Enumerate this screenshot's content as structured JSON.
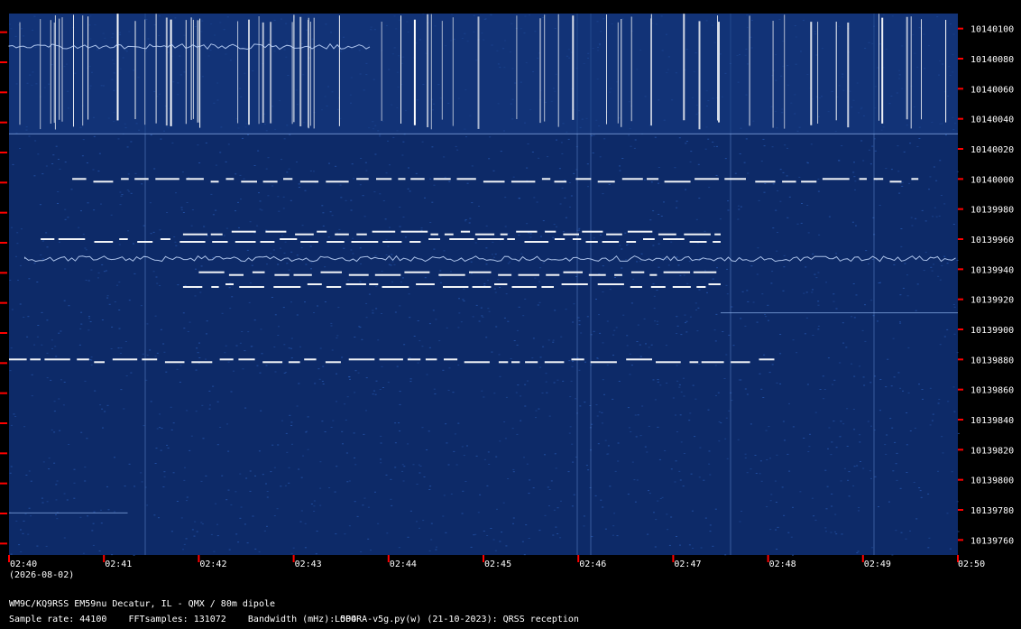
{
  "chart_data": {
    "type": "heatmap",
    "title": "",
    "x_ticks": [
      "02:40",
      "02:41",
      "02:42",
      "02:43",
      "02:44",
      "02:45",
      "02:46",
      "02:47",
      "02:48",
      "02:49",
      "02:50"
    ],
    "date_label": "(2026-08-02)",
    "y_ticks": [
      "10140100",
      "10140080",
      "10140060",
      "10140040",
      "10140020",
      "10140000",
      "10139980",
      "10139960",
      "10139940",
      "10139920",
      "10139900",
      "10139880",
      "10139860",
      "10139840",
      "10139820",
      "10139800",
      "10139780",
      "10139760"
    ],
    "ylim": [
      10139750,
      10140110
    ],
    "signals": [
      {
        "freq": 10140088,
        "start": "02:40",
        "end": "02:43:50",
        "kind": "wavy"
      },
      {
        "freq": 10140000,
        "start": "02:40:40",
        "end": "02:49:35",
        "kind": "keyed"
      },
      {
        "freq": 10139965,
        "start": "02:41:50",
        "end": "02:47:30",
        "kind": "keyed"
      },
      {
        "freq": 10139960,
        "start": "02:40:20",
        "end": "02:47:30",
        "kind": "keyed"
      },
      {
        "freq": 10139947,
        "start": "02:40:10",
        "end": "02:50",
        "kind": "wavy"
      },
      {
        "freq": 10139938,
        "start": "02:42",
        "end": "02:47:30",
        "kind": "keyed"
      },
      {
        "freq": 10139930,
        "start": "02:41:50",
        "end": "02:47:30",
        "kind": "keyed"
      },
      {
        "freq": 10139880,
        "start": "02:40",
        "end": "02:48:05",
        "kind": "keyed"
      },
      {
        "freq": 10139911,
        "start": "02:47:30",
        "end": "02:50",
        "kind": "faint"
      },
      {
        "freq": 10139778,
        "start": "02:40",
        "end": "02:41:15",
        "kind": "faint"
      }
    ]
  },
  "info": {
    "station": "WM9C/KQ9RSS EM59nu Decatur, IL - QMX / 80m dipole",
    "params": "Sample rate: 44100    FFTsamples: 131072    Bandwidth (mHz): 504",
    "software": "LOPORA-v5g.py(w) (21-10-2023): QRSS reception"
  },
  "colors": {
    "background": "#000000",
    "tick": "#ff0000",
    "text": "#ffffff",
    "waterfall_base": "#0d2a68",
    "trace": "#ffffff"
  }
}
